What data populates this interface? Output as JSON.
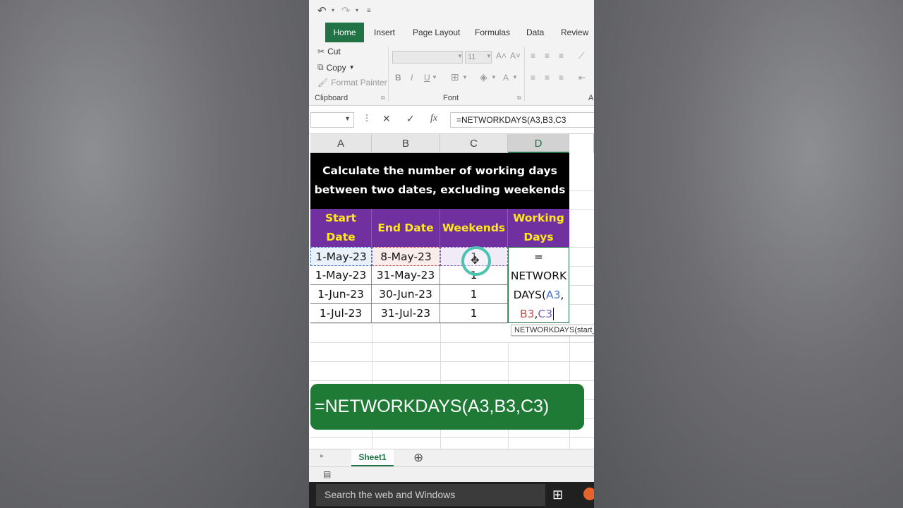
{
  "quick_access": {
    "undo_icon": "undo-icon",
    "redo_icon": "redo-icon",
    "customize_icon": "customize-icon"
  },
  "ribbon": {
    "tabs": [
      {
        "label": "Home",
        "active": true
      },
      {
        "label": "Insert"
      },
      {
        "label": "Page Layout"
      },
      {
        "label": "Formulas"
      },
      {
        "label": "Data"
      },
      {
        "label": "Review"
      }
    ],
    "clipboard": {
      "cut": "Cut",
      "copy": "Copy",
      "format_painter": "Format Painter",
      "group_label": "Clipboard"
    },
    "font": {
      "font_size": "11",
      "bold": "B",
      "italic": "I",
      "underline": "U",
      "group_label": "Font"
    },
    "alignment_group_partial": "A"
  },
  "formula_bar": {
    "cancel": "✕",
    "enter": "✓",
    "fx": "fx",
    "value": "=NETWORKDAYS(A3,B3,C3"
  },
  "columns": [
    "A",
    "B",
    "C",
    "D"
  ],
  "selected_column": "D",
  "sheet": {
    "title_line1": "Calculate the number of working days",
    "title_line2": "between two dates, excluding weekends",
    "headers": {
      "start_line1": "Start",
      "start_line2": "Date",
      "end": "End Date",
      "weekends": "Weekends",
      "working_line1": "Working",
      "working_line2": "Days"
    },
    "rows": [
      {
        "start": "1-May-23",
        "end": "8-May-23",
        "weekends": "1"
      },
      {
        "start": "1-May-23",
        "end": "31-May-23",
        "weekends": "1"
      },
      {
        "start": "1-Jun-23",
        "end": "30-Jun-23",
        "weekends": "1"
      },
      {
        "start": "1-Jul-23",
        "end": "31-Jul-23",
        "weekends": "1"
      }
    ],
    "formula_in_cell": {
      "line1": "=",
      "line2": "NETWORK",
      "line3_text": "DAYS(",
      "line3_ref": "A3",
      "line3_comma": ",",
      "line4_ref_b": "B3",
      "line4_comma": ",",
      "line4_ref_c": "C3"
    },
    "tooltip": "NETWORKDAYS(start_date"
  },
  "banner_text": "=NETWORKDAYS(A3,B3,C3)",
  "sheet_tabs": {
    "active": "Sheet1",
    "add": "⊕"
  },
  "taskbar": {
    "search_placeholder": "Search the web and Windows"
  },
  "colors": {
    "excel_green": "#217346",
    "header_purple": "#7030a0",
    "header_yellow": "#ffe81a",
    "banner_green": "#1e7a35"
  }
}
